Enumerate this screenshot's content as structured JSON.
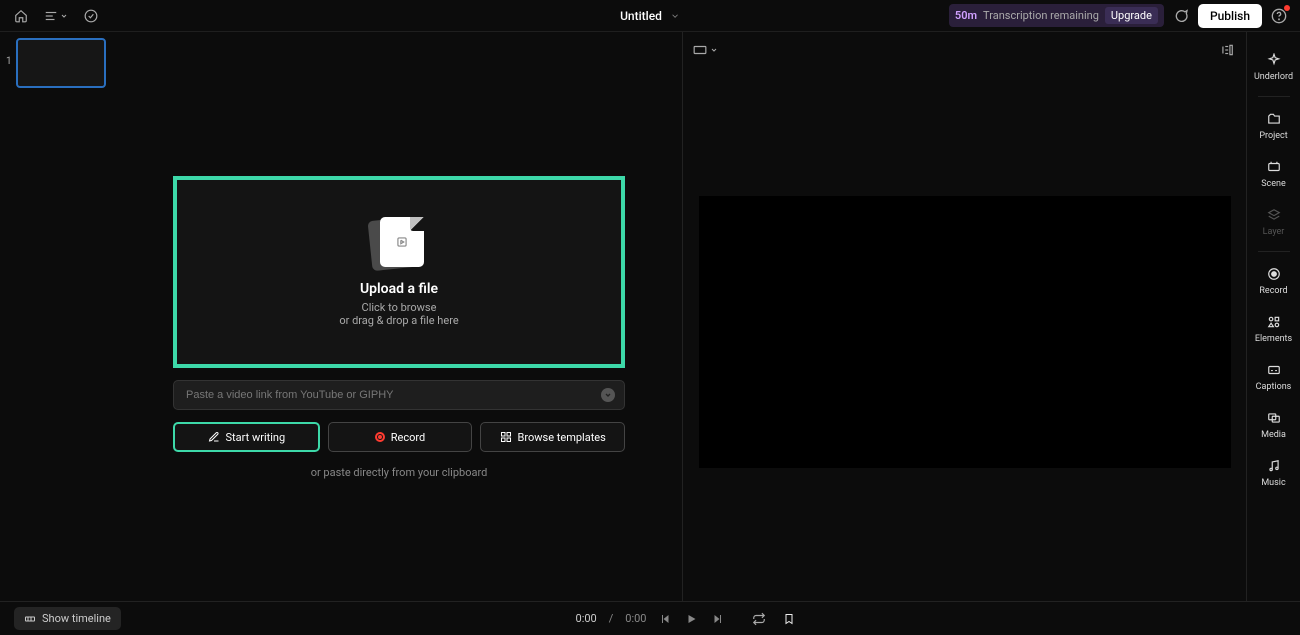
{
  "header": {
    "title": "Untitled",
    "transcription_time": "50m",
    "transcription_label": "Transcription remaining",
    "upgrade_label": "Upgrade",
    "publish_label": "Publish"
  },
  "scenes": {
    "items": [
      {
        "number": "1"
      }
    ]
  },
  "upload": {
    "title": "Upload a file",
    "line1": "Click to browse",
    "line2": "or drag & drop a file here"
  },
  "link_input": {
    "placeholder": "Paste a video link from YouTube or GIPHY"
  },
  "actions": {
    "write": "Start writing",
    "record": "Record",
    "templates": "Browse templates",
    "clipboard_hint": "or paste directly from your clipboard"
  },
  "sidebar": {
    "items": [
      {
        "label": "Underlord"
      },
      {
        "label": "Project"
      },
      {
        "label": "Scene"
      },
      {
        "label": "Layer"
      },
      {
        "label": "Record"
      },
      {
        "label": "Elements"
      },
      {
        "label": "Captions"
      },
      {
        "label": "Media"
      },
      {
        "label": "Music"
      }
    ]
  },
  "bottombar": {
    "show_timeline": "Show timeline",
    "time_current": "0:00",
    "time_total": "0:00",
    "time_sep": "/"
  }
}
